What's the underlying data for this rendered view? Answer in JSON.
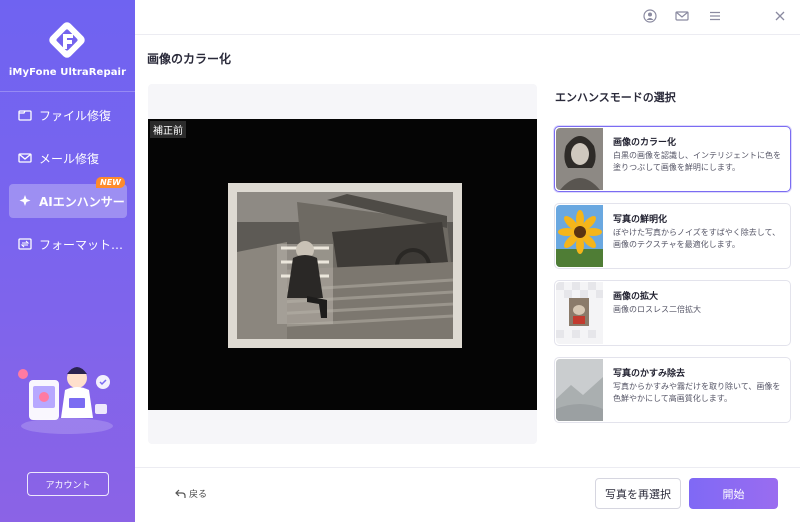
{
  "app": {
    "brand": "iMyFone UltraRepair"
  },
  "sidebar": {
    "items": [
      {
        "label": "ファイル修復",
        "icon": "file-repair-icon"
      },
      {
        "label": "メール修復",
        "icon": "mail-repair-icon"
      },
      {
        "label": "AIエンハンサー",
        "icon": "ai-enhancer-icon",
        "badge": "NEW",
        "active": true
      },
      {
        "label": "フォーマット…",
        "icon": "format-convert-icon"
      }
    ],
    "account_label": "アカウント"
  },
  "topbar": {
    "icons": [
      "account-icon",
      "mail-icon",
      "menu-icon",
      "close-icon"
    ]
  },
  "main": {
    "title": "画像のカラー化",
    "preview": {
      "before_label": "補正前"
    }
  },
  "modes": {
    "title": "エンハンスモードの選択",
    "items": [
      {
        "name": "画像のカラー化",
        "desc": "白黒の画像を認識し、インテリジェントに色を塗りつぶして画像を鮮明にします。",
        "selected": true
      },
      {
        "name": "写真の鮮明化",
        "desc": "ぼやけた写真からノイズをすばやく除去して、画像のテクスチャを最適化します。",
        "selected": false
      },
      {
        "name": "画像の拡大",
        "desc": "画像のロスレス二倍拡大",
        "selected": false
      },
      {
        "name": "写真のかすみ除去",
        "desc": "写真からかすみや霧だけを取り除いて、画像を色鮮やかにして高画質化します。",
        "selected": false
      }
    ]
  },
  "footer": {
    "back_label": "戻る",
    "reselect_label": "写真を再選択",
    "start_label": "開始"
  },
  "colors": {
    "sidebar_top": "#6f63f1",
    "sidebar_bottom": "#8b63e6",
    "accent": "#7b6cf2",
    "badge": "#ff8b2c"
  }
}
